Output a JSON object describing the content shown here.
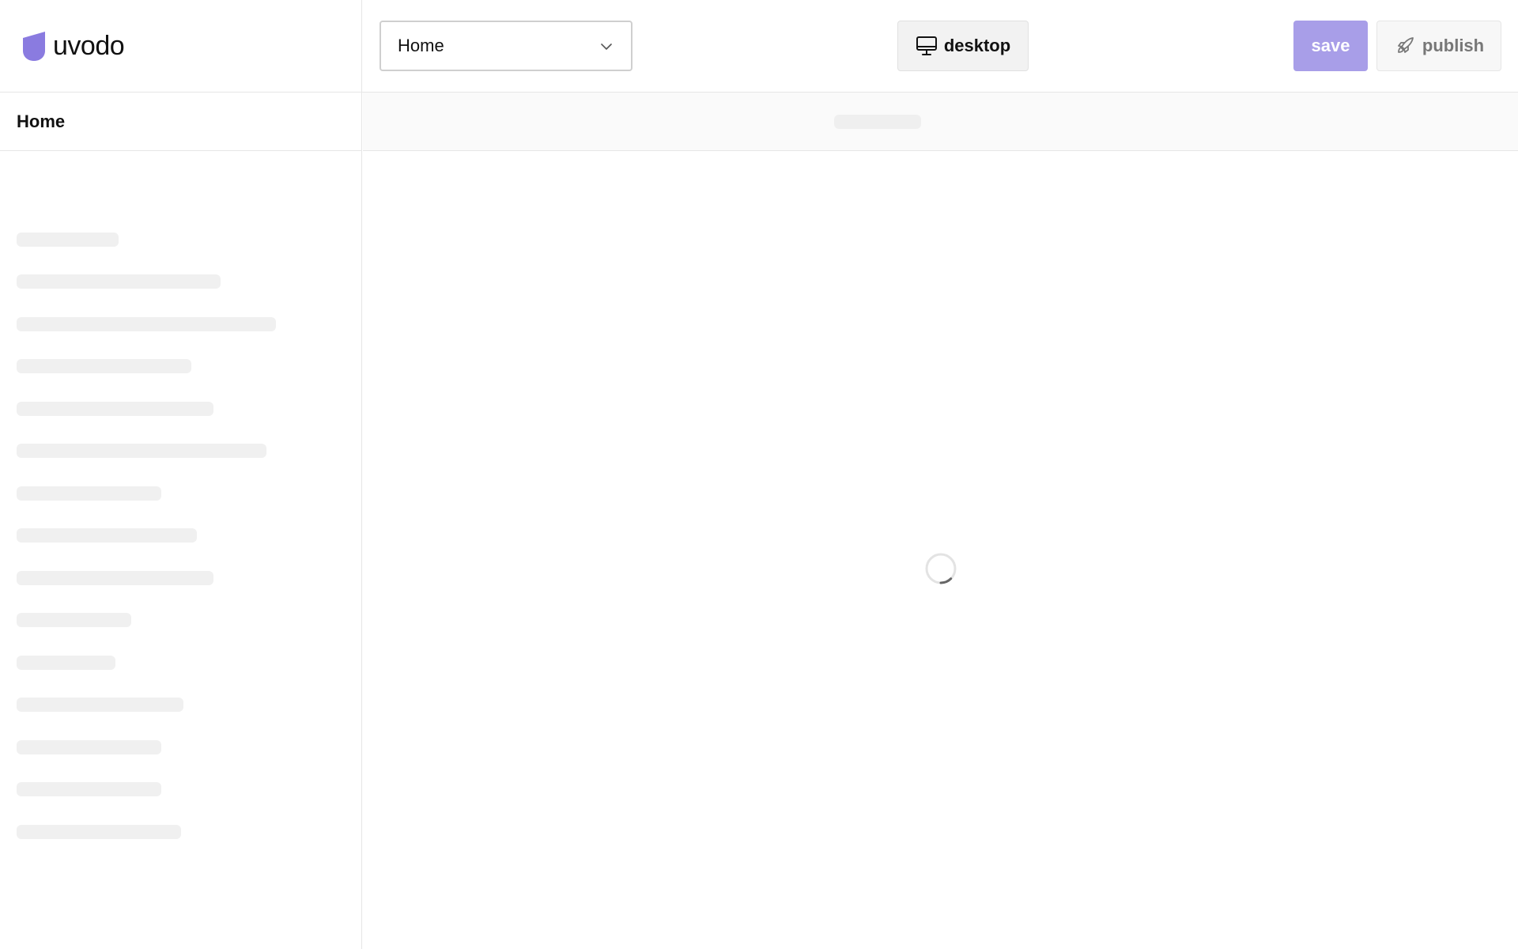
{
  "header": {
    "logo_text": "uvodo",
    "page_select_value": "Home",
    "device_label": "desktop",
    "save_label": "save",
    "publish_label": "publish"
  },
  "sidebar": {
    "title": "Home",
    "skeleton_rows": 15
  },
  "icons": {
    "logo": "uvodo-logo-icon",
    "dropdown": "chevron-down-icon",
    "device": "monitor-icon",
    "publish": "rocket-icon",
    "loading": "spinner-icon"
  },
  "colors": {
    "brand": "#8a7be0",
    "save_button": "#a89ee8",
    "skeleton": "#f0f0f0"
  }
}
